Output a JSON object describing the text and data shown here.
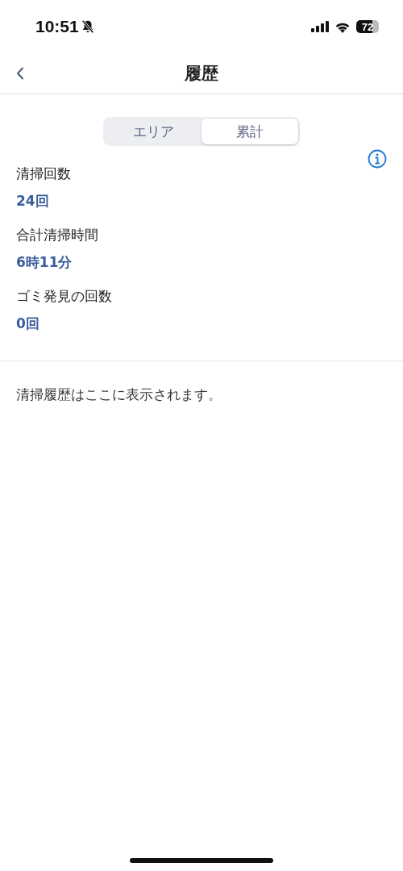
{
  "status_bar": {
    "time": "10:51",
    "battery": "72"
  },
  "nav": {
    "title": "履歴"
  },
  "tabs": [
    {
      "label": "エリア",
      "selected": false
    },
    {
      "label": "累計",
      "selected": true
    }
  ],
  "stats": [
    {
      "label": "清掃回数",
      "value": "24回"
    },
    {
      "label": "合計清掃時間",
      "value": "6時11分"
    },
    {
      "label": "ゴミ発見の回数",
      "value": "0回"
    }
  ],
  "message": "清掃履歴はここに表示されます。"
}
